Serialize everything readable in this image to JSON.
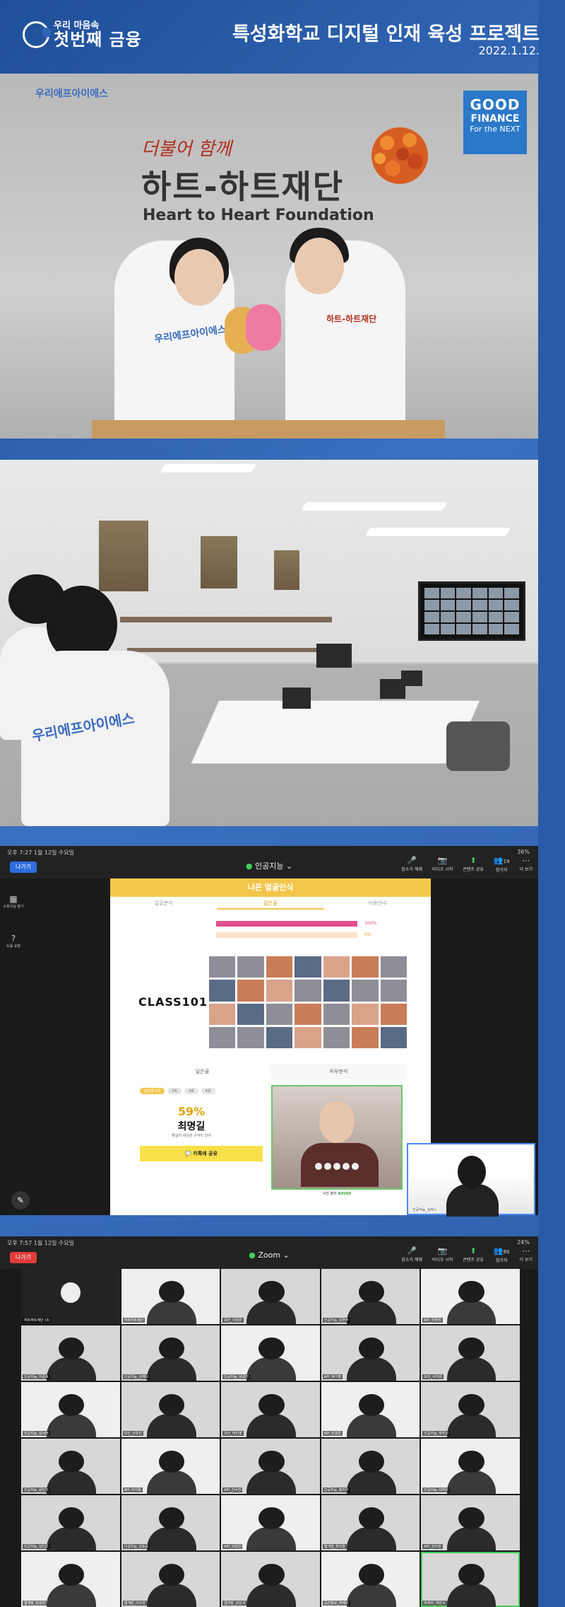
{
  "header": {
    "logo_sub": "우리 마음속",
    "logo_main": "첫번째 금융",
    "title": "특성화학교 디지털 인재 육성 프로젝트",
    "date": "2022.1.12."
  },
  "photo1": {
    "corp_label": "우리에프아이에스",
    "slogan": "더불어 함께",
    "foundation_ko": "하트-하트재단",
    "foundation_en": "Heart to Heart Foundation",
    "badge": {
      "line1": "GOOD",
      "line2": "FINANCE",
      "line3": "For the NEXT"
    },
    "shirt_left": "우리에프아이에스",
    "shirt_right": "하트-하트재단"
  },
  "photo2": {
    "shirt_text": "우리에프아이에스"
  },
  "zoom1": {
    "status_time": "오후 7:27   1월 12일 수요일",
    "battery": "36%",
    "exit_label": "나가기",
    "meeting_name": "인공지능",
    "toolbar": [
      {
        "icon": "🎤",
        "label": "음소거 해제"
      },
      {
        "icon": "📷",
        "label": "비디오 시작"
      },
      {
        "icon": "⬆",
        "label": "콘텐츠 공유"
      },
      {
        "icon": "👥",
        "label": "참가자"
      },
      {
        "icon": "⋯",
        "label": "더 보기"
      }
    ],
    "participants_count": "19",
    "side_items": [
      {
        "icon": "▦",
        "label": "소회의실 참가"
      },
      {
        "icon": "?",
        "label": "도움 요청"
      }
    ],
    "shared": {
      "app_title": "나은 얼굴인식",
      "tabs": [
        "얼굴분석",
        "닮은꼴",
        "이용안내"
      ],
      "active_tab": "닮은꼴",
      "bars": [
        {
          "label": "100%",
          "value": 100
        },
        {
          "label": "0%",
          "value": 0
        }
      ],
      "brand": "CLASS101",
      "result_tabs": [
        "닮은꼴",
        "피부분석"
      ],
      "chips": [
        "닮은꼴 1위",
        "2위",
        "3위",
        "4위"
      ],
      "match_percent": "59%",
      "match_name": "최명길",
      "match_desc": "확실히 비슷한 구석이 있어",
      "share_button": "카톡에 공유",
      "caption_prefix": "사진 출처 ",
      "caption_link": "NAVER"
    },
    "self_view_name": "인공지능_김하니"
  },
  "zoom2": {
    "status_time": "오후 7:57   1월 12일 수요일",
    "battery": "24%",
    "exit_label": "나가기",
    "meeting_name": "Zoom",
    "toolbar": [
      {
        "icon": "🎤",
        "label": "음소거 해제"
      },
      {
        "icon": "📷",
        "label": "비디오 시작"
      },
      {
        "icon": "⬆",
        "label": "콘텐츠 공유"
      },
      {
        "icon": "👥",
        "label": "참가자"
      },
      {
        "icon": "⋯",
        "label": "더 보기"
      }
    ],
    "participants_count": "80",
    "tiles": [
      "하트하트재단 (3)",
      "하트하트재단",
      "보안_이정민",
      "인공지능_김연주",
      "API_우현지",
      "인공지능_이준호",
      "인공지능_김예나",
      "인공지능_남궁진",
      "API_박가영",
      "보안_서지원",
      "인공지능_김서현",
      "보안_이유진",
      "보안_박민영",
      "API_민경준",
      "인공지능_박지원",
      "인공지능_김민지",
      "API_이지호",
      "API_안수빈",
      "인공지능_정지우",
      "인공지능_이하은",
      "인공지능_김민준",
      "인공지능_김도윤",
      "API_이은빈",
      "웹개발_최지훈",
      "API_한수현",
      "웹개발_장승현",
      "웹개발_이수연",
      "웹개발_강민서",
      "공간정보_박재원",
      "박재아_박민서"
    ]
  }
}
